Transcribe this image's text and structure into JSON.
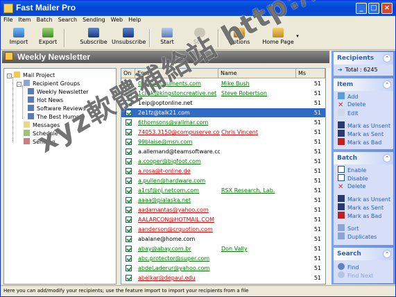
{
  "window": {
    "title": "Fast Mailer Pro",
    "buttons": [
      "_",
      "□",
      "×"
    ]
  },
  "menu": [
    "File",
    "Item",
    "Batch",
    "Search",
    "Sending",
    "Web",
    "Help"
  ],
  "toolbar": {
    "import": "Import",
    "export": "Export",
    "subscribe": "Subscribe",
    "unsubscribe": "Unsubscribe",
    "start": "Start",
    "stop": "Stop",
    "options": "Options",
    "home_page": "Home Page"
  },
  "header": {
    "title": "Weekly Newsletter"
  },
  "tree": {
    "root": "Mail Project",
    "recipient_groups": "Recipient Groups",
    "groups": [
      "Weekly Newsletter",
      "Hot News",
      "Software Reviews",
      "The Best Humor"
    ],
    "messages": "Messages",
    "schedule": "Schedule",
    "sending": "Sending"
  },
  "grid": {
    "columns": [
      "On",
      "Email",
      "Name",
      "Ms"
    ],
    "rows": [
      {
        "email": "02@2instruments.com",
        "name": "Mike Bush",
        "ms": "51",
        "style": "link"
      },
      {
        "email": "1click@kingstoncreative.net",
        "name": "Steve Robertson",
        "ms": "51",
        "style": "link"
      },
      {
        "email": "1eip@optonline.net",
        "name": "",
        "ms": "51",
        "style": "plain"
      },
      {
        "email": "2e1fz@talk21.com",
        "name": "",
        "ms": "51",
        "style": "sel"
      },
      {
        "email": "6thomsons@vallmar.com",
        "name": "",
        "ms": "51",
        "style": "link"
      },
      {
        "email": "74053.3150@compuserve.com",
        "name": "Chris Vincent",
        "ms": "51",
        "style": "red"
      },
      {
        "email": "99blaise@msn.com",
        "name": "",
        "ms": "51",
        "style": "link"
      },
      {
        "email": "a.allemand@teamsoftware.com",
        "name": "",
        "ms": "51",
        "style": "plain"
      },
      {
        "email": "a.cooper@bigfoot.com",
        "name": "",
        "ms": "51",
        "style": "link"
      },
      {
        "email": "a.rosa@t-online.de",
        "name": "",
        "ms": "51",
        "style": "red"
      },
      {
        "email": "a.pullen@hardware.com",
        "name": "",
        "ms": "51",
        "style": "link"
      },
      {
        "email": "a1rsf@nj.netcom.com",
        "name": "RSX Research, Lab.",
        "ms": "51",
        "style": "link"
      },
      {
        "email": "aaaa@pialaska.net",
        "name": "",
        "ms": "51",
        "style": "link"
      },
      {
        "email": "aadamantas@yahoo.com",
        "name": "",
        "ms": "51",
        "style": "red"
      },
      {
        "email": "AALARCON@HOTMAIL.COM",
        "name": "",
        "ms": "51",
        "style": "red"
      },
      {
        "email": "aanderson@crquotion.com",
        "name": "",
        "ms": "51",
        "style": "red"
      },
      {
        "email": "abalane@home.com",
        "name": "",
        "ms": "51",
        "style": "plain"
      },
      {
        "email": "abay@abay.com.br",
        "name": "Don Vally",
        "ms": "51",
        "style": "link"
      },
      {
        "email": "abc.protector@super.com",
        "name": "",
        "ms": "51",
        "style": "link"
      },
      {
        "email": "abdel.aderur@yahoo.com",
        "name": "",
        "ms": "51",
        "style": "link"
      },
      {
        "email": "abelkar@depaul.edu",
        "name": "",
        "ms": "51",
        "style": "red"
      }
    ]
  },
  "right": {
    "recipients": {
      "title": "Recipients",
      "total": "Total : 6245"
    },
    "item": {
      "title": "Item",
      "actions": [
        "Add",
        "Delete",
        "Edit",
        "Mark as Unsent",
        "Mark as Sent",
        "Mark as Bad"
      ]
    },
    "batch": {
      "title": "Batch",
      "actions": [
        "Enable",
        "Disable",
        "Delete",
        "Mark as Unsent",
        "Mark as Sent",
        "Mark as Bad",
        "Sort",
        "Duplicates"
      ]
    },
    "search": {
      "title": "Search",
      "actions": [
        "Find",
        "Find Next"
      ]
    }
  },
  "status": {
    "text": "Here you can add/modify your recipients; use the feature Import to import your recipients from a file"
  },
  "watermark": "xyz軟體補給站 http://31.to"
}
